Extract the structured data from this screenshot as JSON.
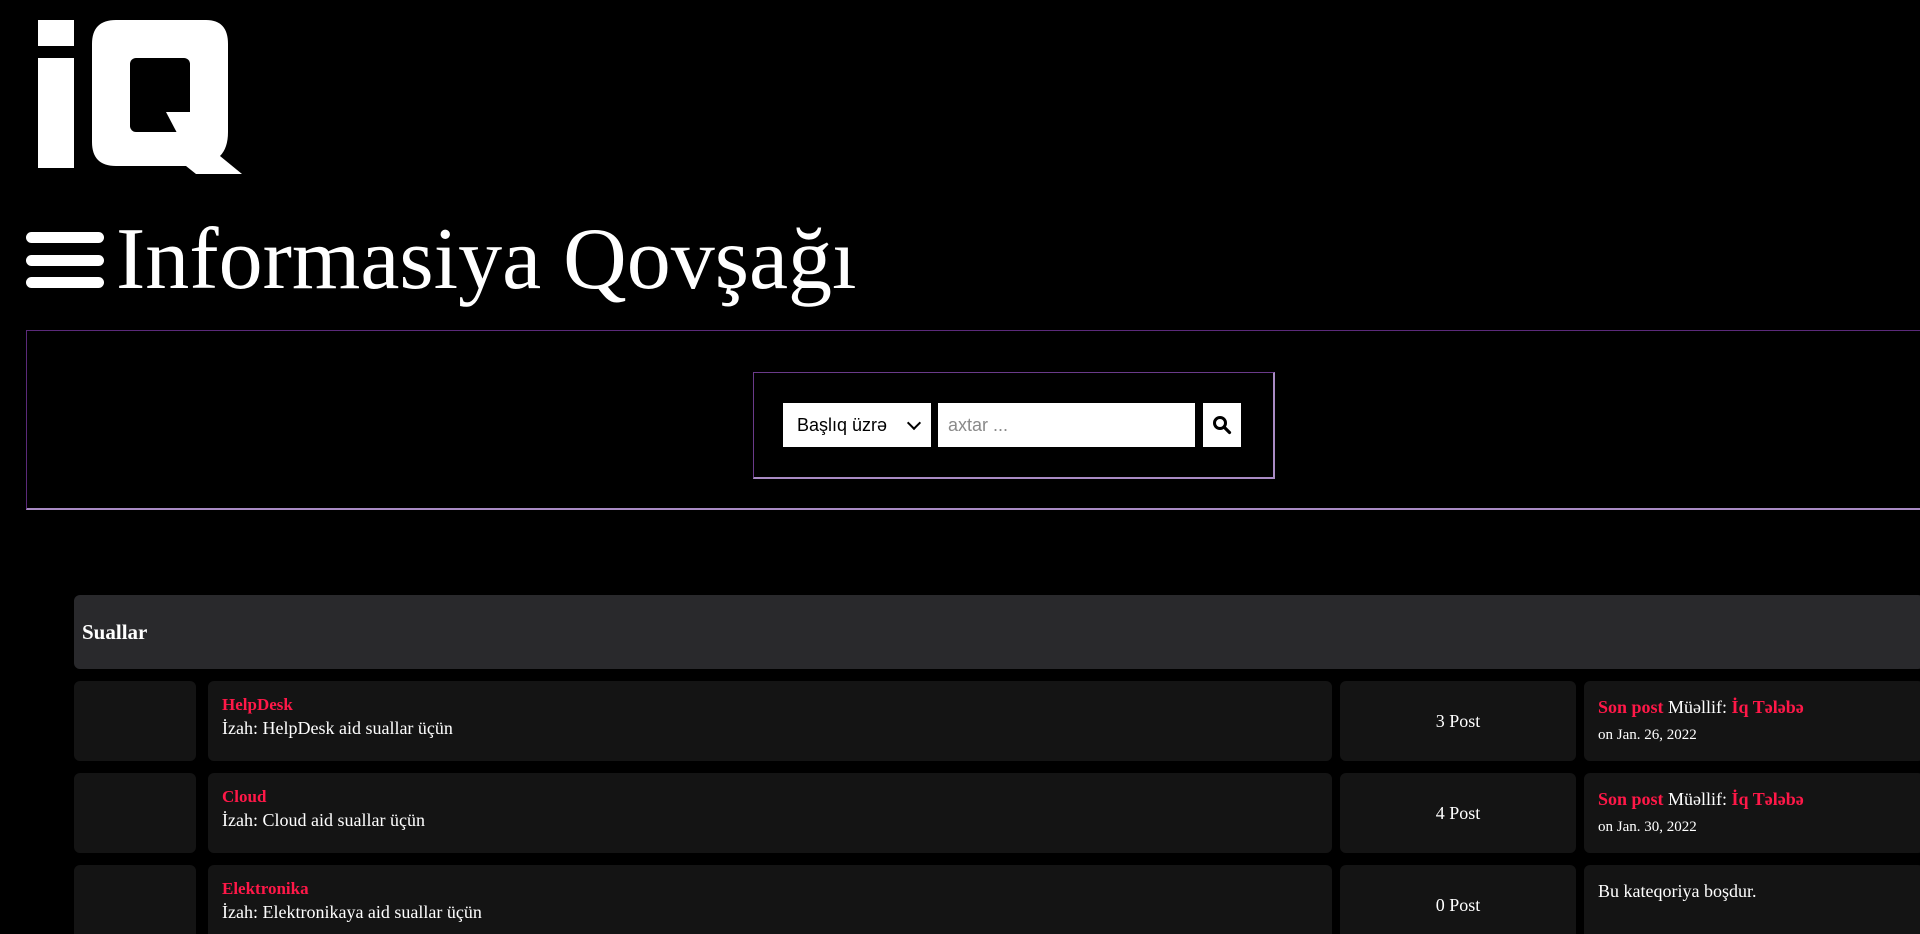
{
  "logo": {
    "text": "iQ"
  },
  "header": {
    "title": "Informasiya Qovşağı"
  },
  "search": {
    "select_value": "Başlıq üzrə",
    "placeholder": "axtar ..."
  },
  "category": {
    "title": "Suallar",
    "forums": [
      {
        "name": "HelpDesk",
        "description": "İzah: HelpDesk aid suallar üçün",
        "count": "3 Post",
        "last_post_label": "Son post",
        "author_prefix": "Müəllif:",
        "author": "İq Tələbə",
        "date": "on Jan. 26, 2022"
      },
      {
        "name": "Cloud",
        "description": "İzah: Cloud aid suallar üçün",
        "count": "4 Post",
        "last_post_label": "Son post",
        "author_prefix": "Müəllif:",
        "author": "İq Tələbə",
        "date": "on Jan. 30, 2022"
      },
      {
        "name": "Elektronika",
        "description": "İzah: Elektronikaya aid suallar üçün",
        "count": "0 Post",
        "empty_text": "Bu kateqoriya boşdur."
      }
    ]
  },
  "colors": {
    "background": "#000000",
    "accent_link": "#ff1848",
    "panel": "#141414",
    "header_panel": "#29292c",
    "border_purple": "#a98bc4"
  },
  "icons": {
    "menu": "hamburger-menu-icon",
    "search": "search-icon",
    "dropdown": "chevron-down-icon"
  }
}
